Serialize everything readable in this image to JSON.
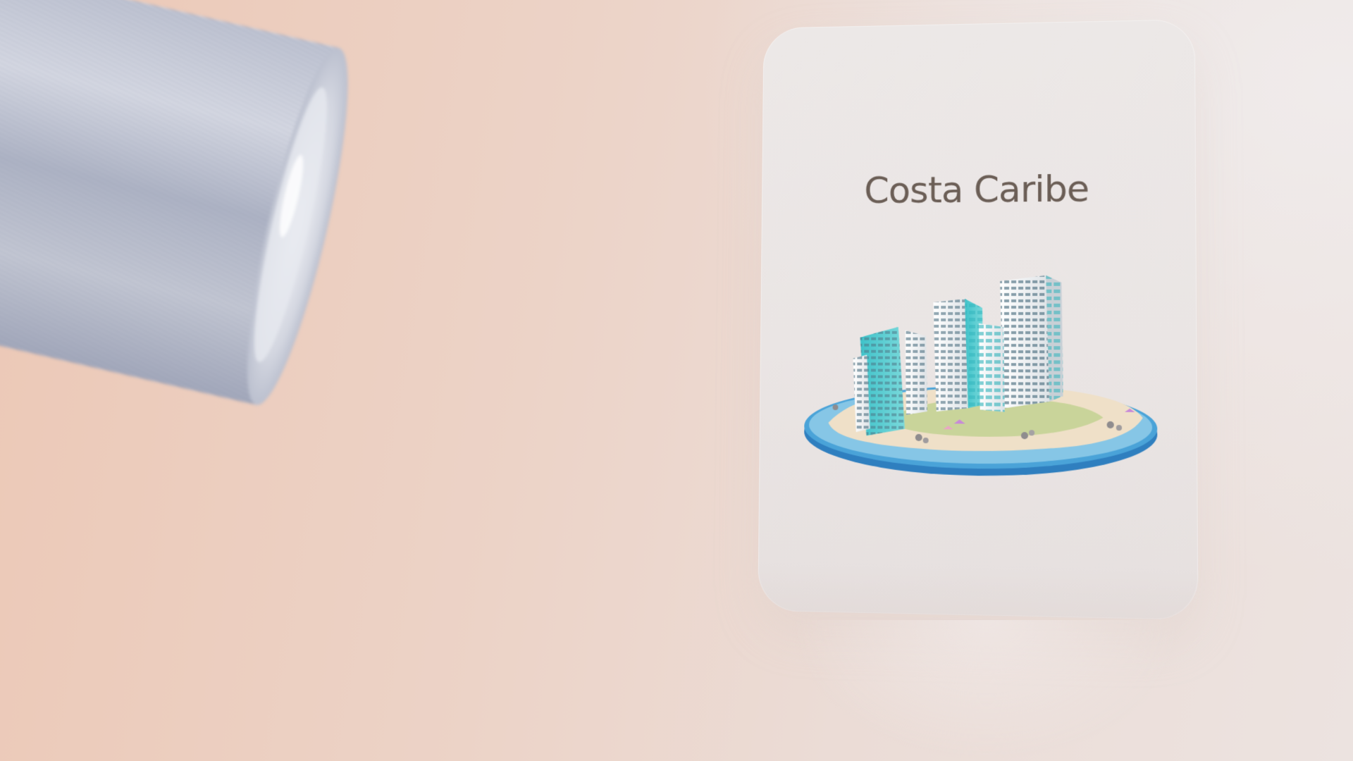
{
  "scene": {
    "background_colors": [
      "#ecc8b6",
      "#ebdcd6",
      "#ece3e0"
    ],
    "cylinder_icon": "metallic-cylinder-icon"
  },
  "card": {
    "title": "Costa Caribe",
    "illustration_icon": "island-city-icon",
    "colors": {
      "title": "#6b5e56",
      "water": "#4aa3d8",
      "buildings": "#3fc2c9",
      "sand": "#efe0c8",
      "grass": "#c9d49a"
    }
  }
}
